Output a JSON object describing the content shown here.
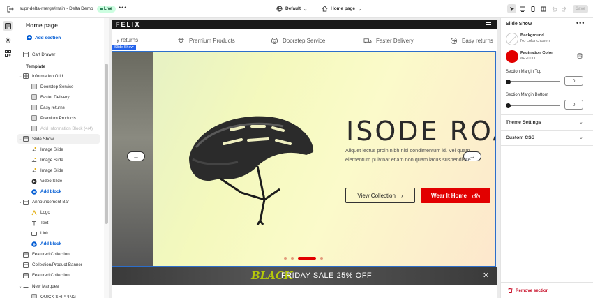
{
  "topbar": {
    "store_title": "supr-delta-merge/main - Delta Demo",
    "live_badge": "Live",
    "more": "•••",
    "theme_select": "Default",
    "page_select": "Home page",
    "save_label": "Save"
  },
  "left_panel": {
    "title": "Home page",
    "add_section": "Add section",
    "cart_drawer": "Cart Drawer",
    "template_label": "Template",
    "items": [
      {
        "label": "Information Grid",
        "level": 0
      },
      {
        "label": "Doorstep Service",
        "level": 1
      },
      {
        "label": "Faster Delivery",
        "level": 1
      },
      {
        "label": "Easy returns",
        "level": 1
      },
      {
        "label": "Premium Products",
        "level": 1
      },
      {
        "label": "Add Information Block (4/4)",
        "level": 1
      },
      {
        "label": "Slide Show",
        "level": 0
      },
      {
        "label": "Image Slide",
        "level": 1
      },
      {
        "label": "Image Slide",
        "level": 1
      },
      {
        "label": "Image Slide",
        "level": 1
      },
      {
        "label": "Video Slide",
        "level": 1
      },
      {
        "label": "Add block",
        "level": 1
      },
      {
        "label": "Announcement Bar",
        "level": 0
      },
      {
        "label": "Logo",
        "level": 1
      },
      {
        "label": "Text",
        "level": 1
      },
      {
        "label": "Link",
        "level": 1
      },
      {
        "label": "Add block",
        "level": 1
      },
      {
        "label": "Featured Collection",
        "level": 0
      },
      {
        "label": "Collection/Product Banner",
        "level": 0
      },
      {
        "label": "Featured Collection",
        "level": 0
      },
      {
        "label": "New Marquee",
        "level": 0
      },
      {
        "label": "QUICK SHIPPING",
        "level": 1
      }
    ]
  },
  "preview": {
    "logo": "FELIX",
    "info_items": [
      "y returns",
      "Premium Products",
      "Doorstep Service",
      "Faster Delivery",
      "Easy returns"
    ],
    "slide_tag": "Slide Show",
    "heading": "ISODE ROAD",
    "paragraph": "Aliquet lectus proin nibh nisl condimentum id. Vel quam elementum pulvinar etiam non quam lacus suspendisse.",
    "btn_view": "View Collection",
    "btn_wear": "Wear It Home",
    "announce_black": "BLACK",
    "announce_text": "FRIDAY SALE  25% OFF",
    "accent_color": "#E20000"
  },
  "right_panel": {
    "title": "Slide Show",
    "background_label": "Background",
    "background_value": "No color chosen",
    "pagination_label": "Pagination Color",
    "pagination_value": "#E20000",
    "margin_top_label": "Section Margin Top",
    "margin_top_value": "0",
    "margin_bottom_label": "Section Margin Bottom",
    "margin_bottom_value": "0",
    "theme_settings": "Theme Settings",
    "custom_css": "Custom CSS",
    "remove_section": "Remove section"
  }
}
